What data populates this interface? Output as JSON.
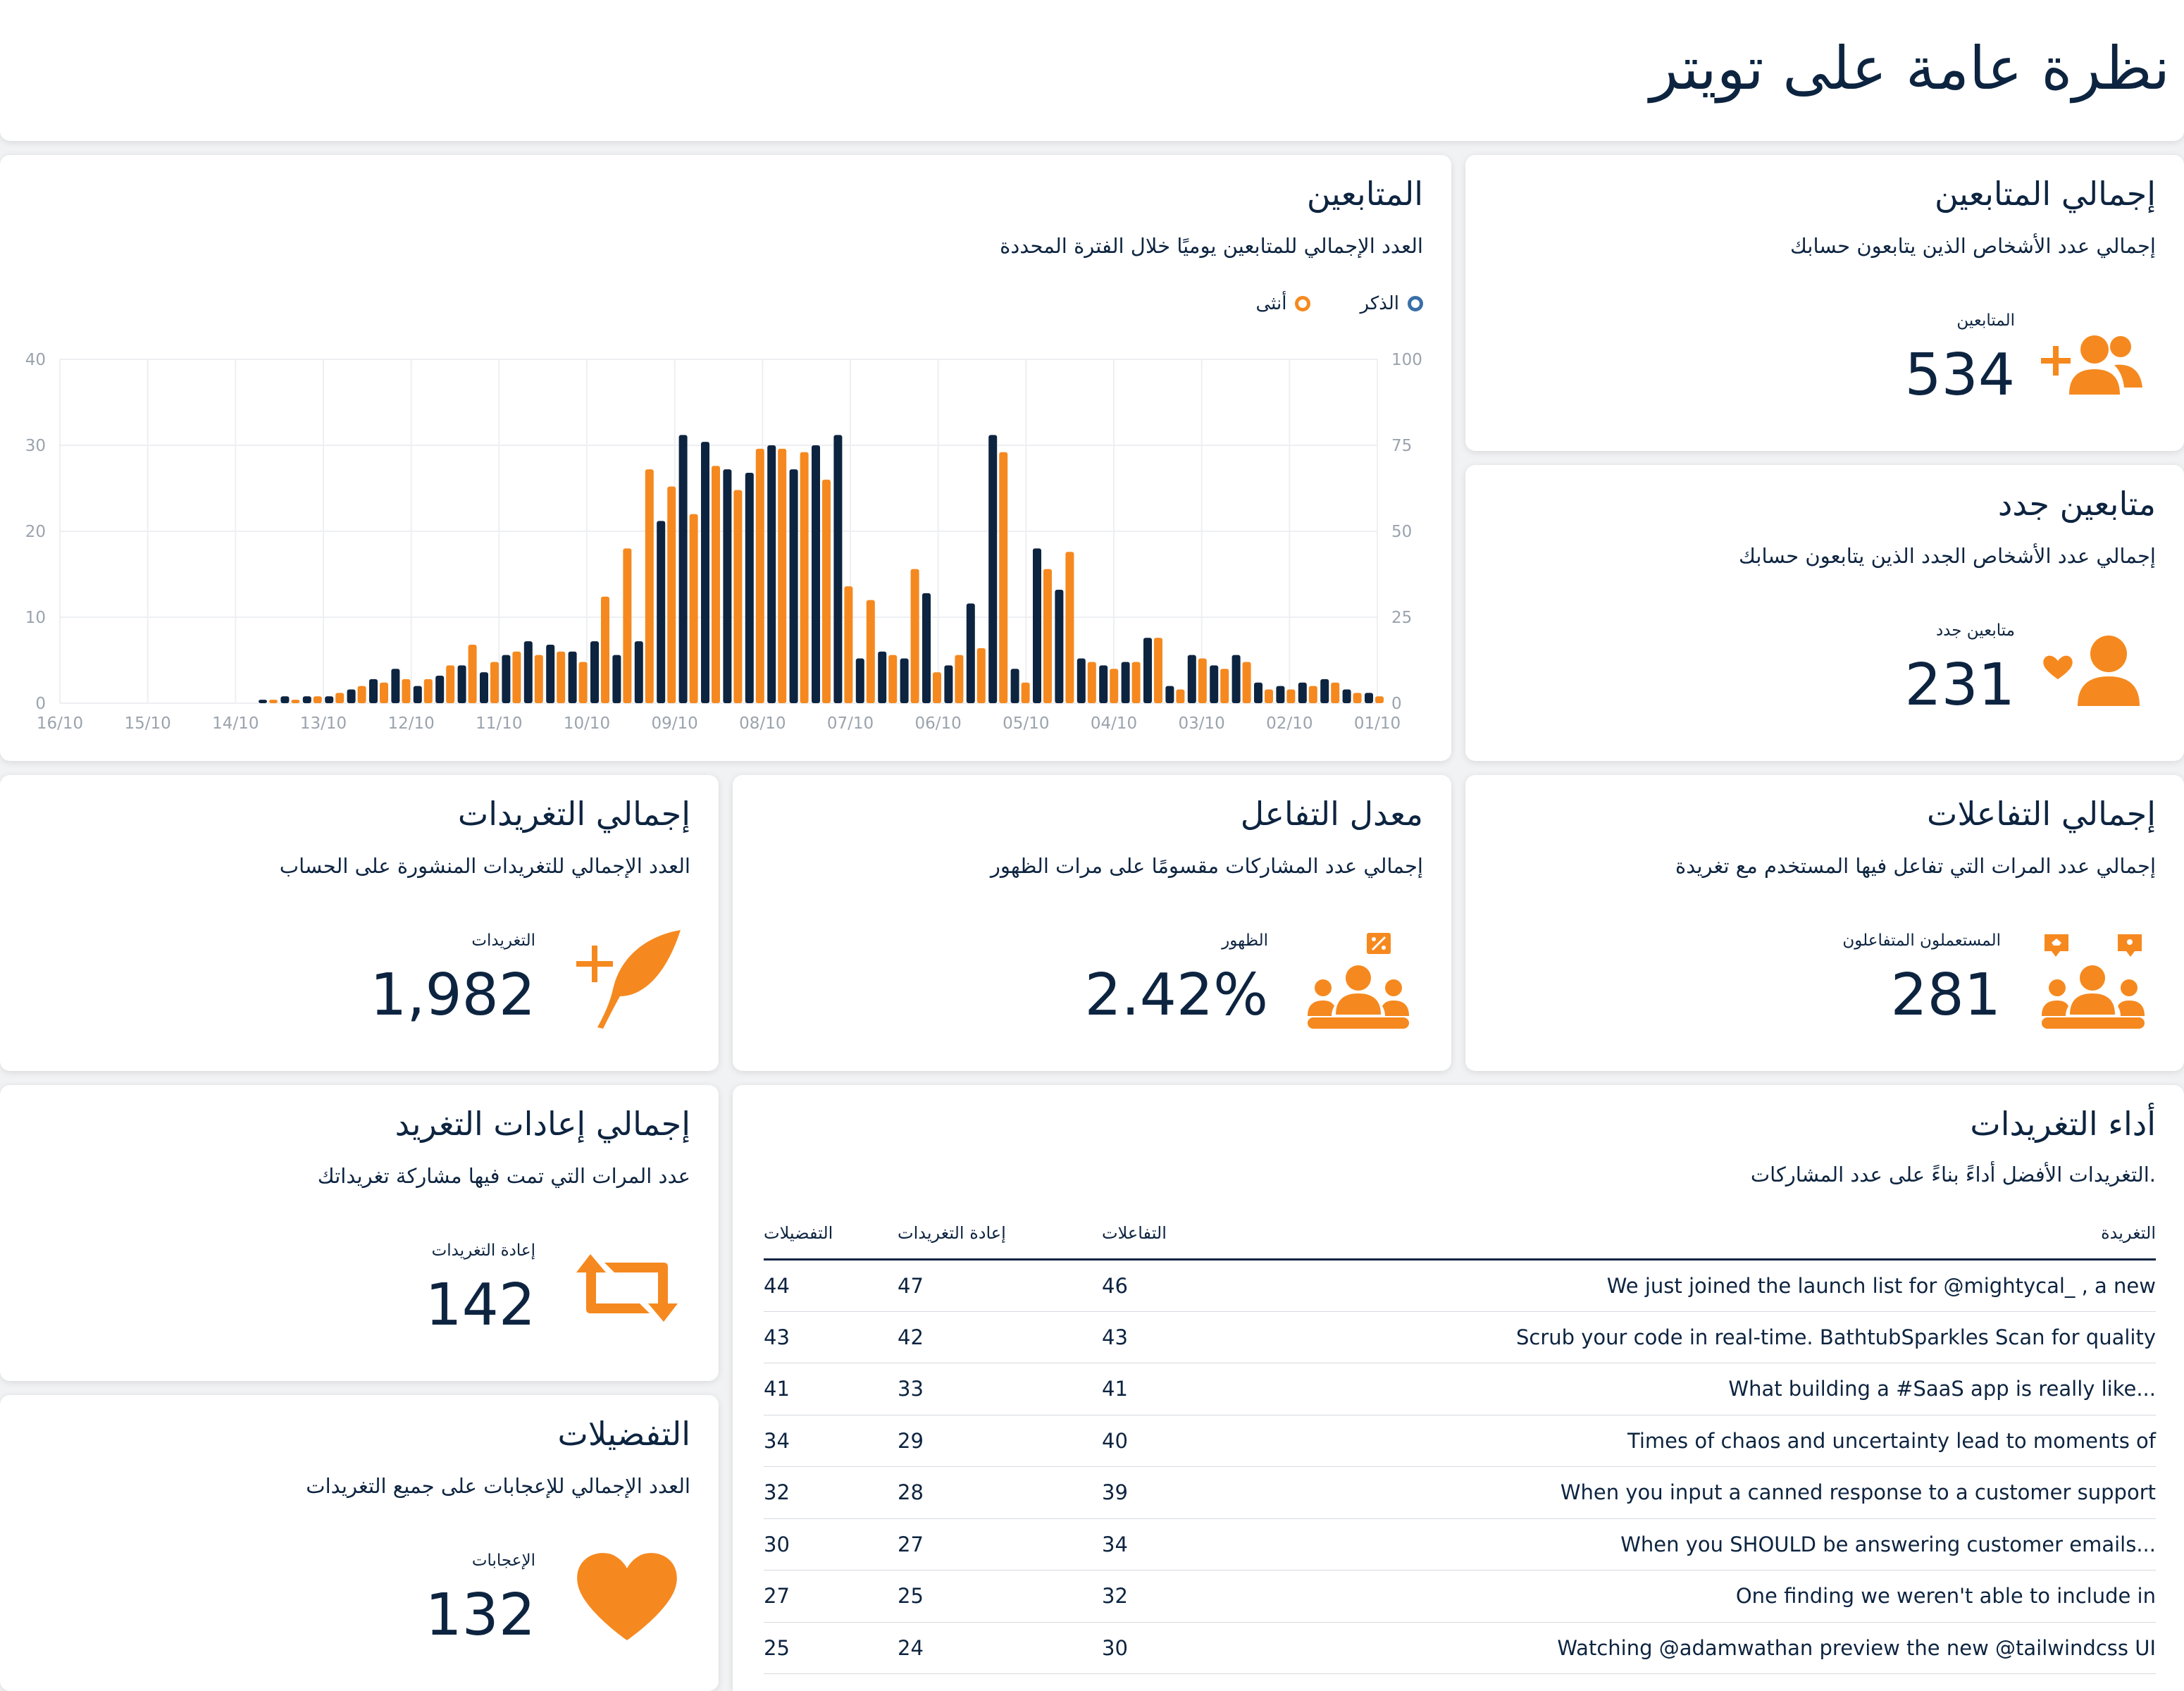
{
  "page": {
    "title": "نظرة عامة على تويتر"
  },
  "colors": {
    "navy": "#0d2440",
    "orange": "#f5891f",
    "grid": "#eeeff2",
    "axis": "#9aa3ad"
  },
  "followers_chart": {
    "title": "المتابعين",
    "subtitle": "العدد الإجمالي للمتابعين يوميًا خلال الفترة المحددة",
    "legend": {
      "male": "الذكر",
      "female": "أنثى"
    }
  },
  "total_followers": {
    "title": "إجمالي المتابعين",
    "subtitle": "إجمالي عدد الأشخاص الذين يتابعون حسابك",
    "label": "المتابعين",
    "value": "534",
    "icon": "user-plus-icon"
  },
  "new_followers": {
    "title": "متابعين جدد",
    "subtitle": "إجمالي عدد الأشخاص الجدد الذين يتابعون حسابك",
    "label": "متابعين جدد",
    "value": "231",
    "icon": "user-heart-icon"
  },
  "total_tweets": {
    "title": "إجمالي التغريدات",
    "subtitle": "العدد الإجمالي للتغريدات المنشورة على الحساب",
    "label": "التغريدات",
    "value": "1,982",
    "icon": "feather-plus-icon"
  },
  "engagement_rate": {
    "title": "معدل التفاعل",
    "subtitle": "إجمالي عدد المشاركات مقسومًا على مرات الظهور",
    "label": "الظهور",
    "value": "2.42%",
    "icon": "group-percent-icon"
  },
  "total_interactions": {
    "title": "إجمالي التفاعلات",
    "subtitle": "إجمالي عدد المرات التي تفاعل فيها المستخدم مع تغريدة",
    "label": "المستعملون المتفاعلون",
    "value": "281",
    "icon": "group-chat-icon"
  },
  "total_retweets": {
    "title": "إجمالي إعادات التغريد",
    "subtitle": "عدد المرات التي تمت فيها مشاركة تغريداتك",
    "label": "إعادة التغريدات",
    "value": "142",
    "icon": "retweet-icon"
  },
  "favorites": {
    "title": "التفضيلات",
    "subtitle": "العدد الإجمالي للإعجابات على جميع التغريدات",
    "label": "الإعجابات",
    "value": "132",
    "icon": "heart-icon"
  },
  "tweet_performance": {
    "title": "أداء التغريدات",
    "subtitle": ".التغريدات الأفضل أداءً بناءً على عدد المشاركات",
    "columns": [
      "التغريدة",
      "التفاعلات",
      "إعادة التغريدات",
      "التفضيلات"
    ],
    "rows": [
      {
        "tweet": "We just joined the launch list for  @mightycal_ , a new",
        "interactions": "46",
        "retweets": "47",
        "favorites": "44"
      },
      {
        "tweet": "Scrub your code in real-time. BathtubSparkles Scan for quality",
        "interactions": "43",
        "retweets": "42",
        "favorites": "43"
      },
      {
        "tweet": "What building a #SaaS app is really like...",
        "interactions": "41",
        "retweets": "33",
        "favorites": "41"
      },
      {
        "tweet": "Times of chaos and uncertainty lead to moments of",
        "interactions": "40",
        "retweets": "29",
        "favorites": "34"
      },
      {
        "tweet": "When you input a canned response to a customer support",
        "interactions": "39",
        "retweets": "28",
        "favorites": "32"
      },
      {
        "tweet": "When you SHOULD be answering customer emails...",
        "interactions": "34",
        "retweets": "27",
        "favorites": "30"
      },
      {
        "tweet": "One finding we weren't able to include in",
        "interactions": "32",
        "retweets": "25",
        "favorites": "27"
      },
      {
        "tweet": "Watching  @adamwathan  preview the new  @tailwindcss  UI",
        "interactions": "30",
        "retweets": "24",
        "favorites": "25"
      }
    ]
  },
  "chart_data": {
    "type": "bar",
    "title": "المتابعين",
    "x_tick_labels": [
      "01/10",
      "02/10",
      "03/10",
      "04/10",
      "05/10",
      "06/10",
      "07/10",
      "08/10",
      "09/10",
      "10/10",
      "11/10",
      "12/10",
      "13/10",
      "14/10",
      "15/10",
      "16/10"
    ],
    "y_left": {
      "ticks": [
        0,
        10,
        20,
        30,
        40
      ],
      "ylim": [
        0,
        40
      ]
    },
    "y_right": {
      "ticks": [
        0,
        25,
        50,
        75,
        100
      ],
      "ylim": [
        0,
        100
      ]
    },
    "x_order": "right-to-left",
    "series": [
      {
        "name": "الذكر",
        "color": "#0d2440",
        "values": [
          3,
          4,
          7,
          6,
          5,
          6,
          14,
          11,
          14,
          5,
          19,
          12,
          11,
          13,
          33,
          45,
          10,
          78,
          29,
          11,
          32,
          13,
          15,
          13,
          78,
          75,
          68,
          75,
          67,
          68,
          76,
          78,
          53,
          18,
          14,
          18,
          15,
          17,
          18,
          14,
          9,
          11,
          8,
          5,
          10,
          7,
          4,
          2,
          2,
          2,
          1
        ]
      },
      {
        "name": "أنثى",
        "color": "#f5891f",
        "values": [
          2,
          3,
          6,
          5,
          4,
          4,
          12,
          10,
          13,
          4,
          19,
          12,
          10,
          12,
          44,
          39,
          6,
          73,
          16,
          14,
          9,
          39,
          14,
          30,
          34,
          65,
          73,
          74,
          74,
          62,
          69,
          55,
          63,
          68,
          45,
          31,
          12,
          15,
          14,
          15,
          12,
          17,
          11,
          7,
          7,
          6,
          5,
          3,
          2,
          1,
          1
        ]
      }
    ]
  }
}
